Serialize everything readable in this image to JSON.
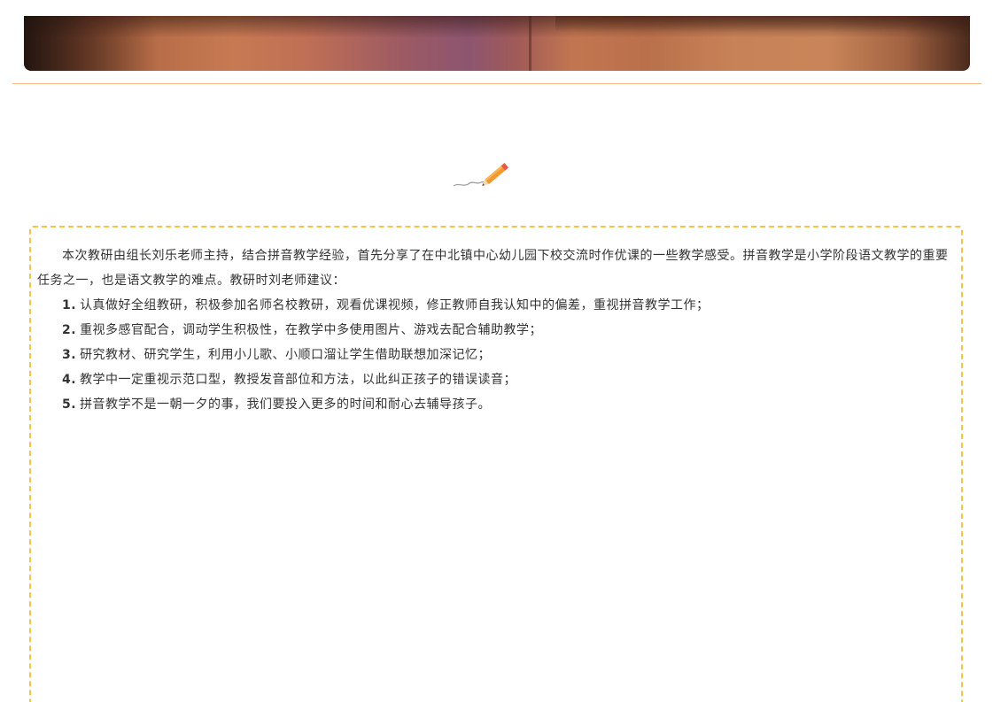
{
  "content": {
    "intro": "本次教研由组长刘乐老师主持，结合拼音教学经验，首先分享了在中北镇中心幼儿园下校交流时作优课的一些教学感受。拼音教学是小学阶段语文教学的重要任务之一，也是语文教学的难点。教研时刘老师建议：",
    "items": [
      {
        "num": "1.",
        "text": "认真做好全组教研，积极参加名师名校教研，观看优课视频，修正教师自我认知中的偏差，重视拼音教学工作；"
      },
      {
        "num": "2.",
        "text": "重视多感官配合，调动学生积极性，在教学中多使用图片、游戏去配合辅助教学；"
      },
      {
        "num": "3.",
        "text": "研究教材、研究学生，利用小儿歌、小顺口溜让学生借助联想加深记忆；"
      },
      {
        "num": "4.",
        "text": "教学中一定重视示范口型，教授发音部位和方法，以此纠正孩子的错误读音；"
      },
      {
        "num": "5.",
        "text": "拼音教学不是一朝一夕的事，我们要投入更多的时间和耐心去辅导孩子。"
      }
    ]
  },
  "decor": {
    "divider_color": "#f3b98a",
    "box_border_color": "#f5c24a",
    "pencil_icon": "pencil-icon"
  }
}
